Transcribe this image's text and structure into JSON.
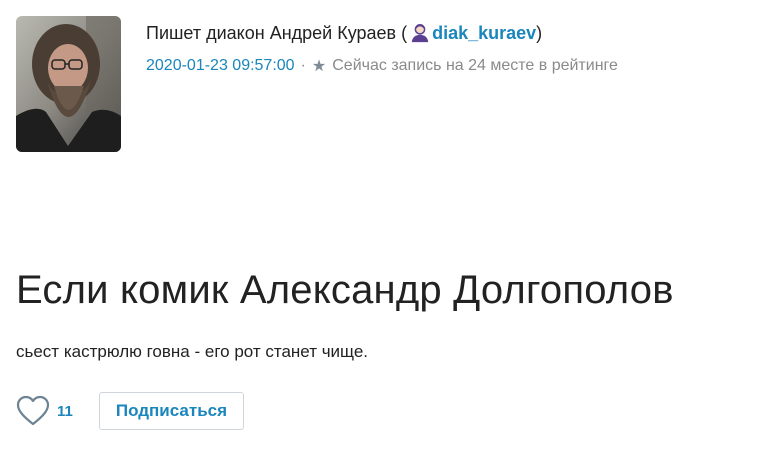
{
  "post": {
    "author_prefix": "Пишет диакон Андрей Кураев (",
    "username": "diak_kuraev",
    "author_suffix": ")",
    "date": "2020-01-23 09:57:00",
    "separator": "·",
    "rating_text": "Сейчас запись на 24 месте в рейтинге",
    "title": "Если комик Александр Долгополов",
    "body": "сьест кастрюлю говна - его рот станет чище."
  },
  "actions": {
    "like_count": "11",
    "subscribe_label": "Подписаться"
  },
  "icons": {
    "user": "user-icon",
    "star": "star-icon",
    "heart": "heart-icon"
  },
  "colors": {
    "link": "#1a86bc",
    "text": "#222222",
    "muted": "#8a8a8a"
  }
}
